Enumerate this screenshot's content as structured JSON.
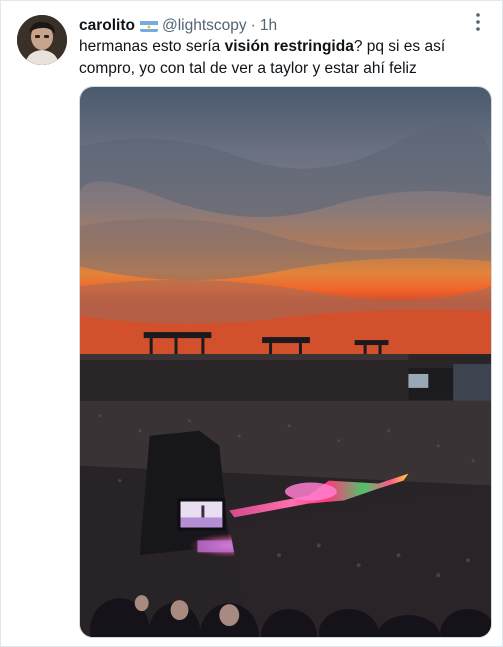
{
  "tweet": {
    "display_name": "carolito",
    "handle": "@lightscopy",
    "separator": "·",
    "time": "1h",
    "text_before": "hermanas esto sería ",
    "text_bold": "visión restringida",
    "text_after": "? pq si es así compro, yo con tal de ver a taylor y estar ahí feliz"
  },
  "icons": {
    "avatar": "profile-photo",
    "flag": "argentina-flag-icon",
    "more": "more-options-icon"
  },
  "colors": {
    "text": "#0f1419",
    "muted": "#536471",
    "border": "#cfd9de"
  }
}
